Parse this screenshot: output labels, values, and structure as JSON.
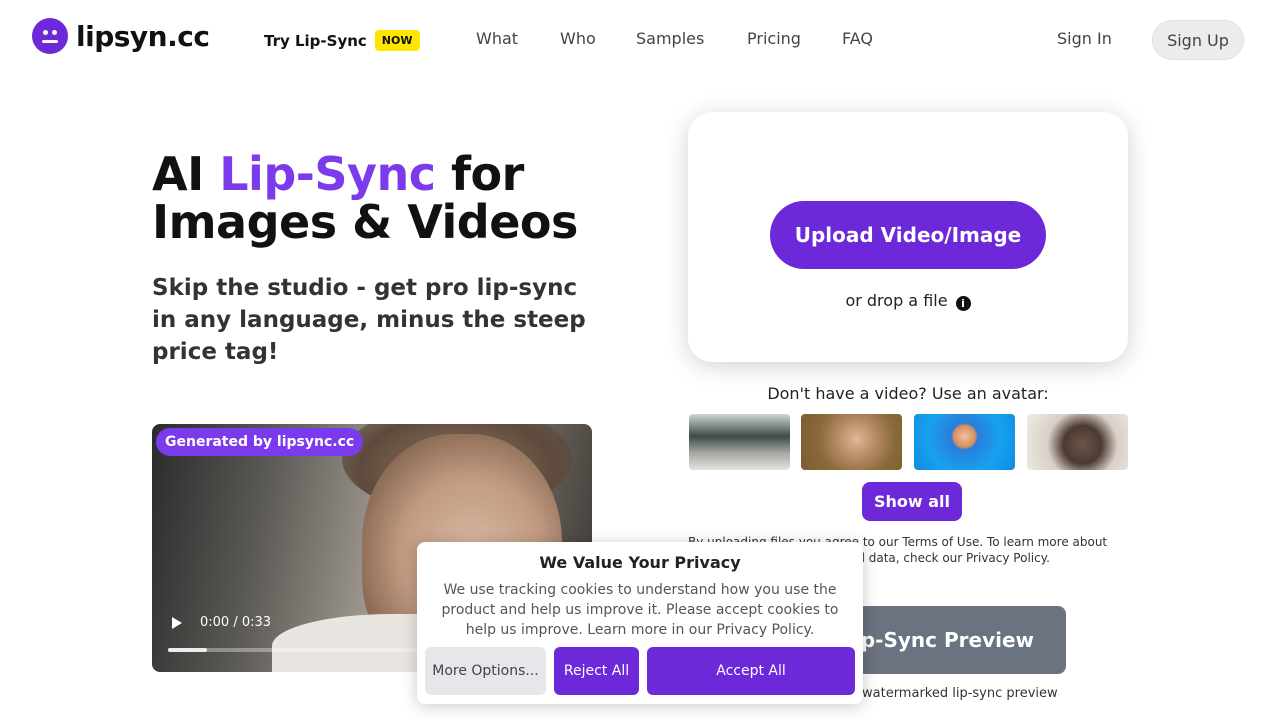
{
  "header": {
    "logo_text": "lipsyn.cc",
    "try_link": "Try Lip-Sync",
    "now_badge": "NOW",
    "nav": [
      "What",
      "Who",
      "Samples",
      "Pricing",
      "FAQ"
    ],
    "sign_in": "Sign In",
    "sign_up": "Sign Up"
  },
  "hero": {
    "title_prefix": "AI ",
    "title_accent": "Lip-Sync",
    "title_suffix": " for",
    "title_line2": "Images & Videos",
    "subtitle": "Skip the studio - get pro lip-sync in any language, minus the steep price tag!"
  },
  "video": {
    "badge": "Generated by lipsync.cc",
    "time": "0:00 / 0:33",
    "progress": 0.15
  },
  "upload": {
    "button": "Upload Video/Image",
    "drop_text": "or drop a file",
    "info_glyph": "i",
    "avatar_label": "Don't have a video? Use an avatar:",
    "show_all": "Show all",
    "terms": "By uploading files you agree to our Terms of Use. To learn more about how we handle your personal data, check our Privacy Policy.",
    "preview_button": "Lip-Sync Preview",
    "preview_note": "watermarked lip-sync preview"
  },
  "cookie": {
    "title": "We Value Your Privacy",
    "text": "We use tracking cookies to understand how you use the product and help us improve it. Please accept cookies to help us improve. Learn more in our Privacy Policy.",
    "more": "More Options...",
    "reject": "Reject All",
    "accept": "Accept All"
  },
  "colors": {
    "accent": "#7c3aed",
    "primary_button": "#6d28d9",
    "badge_yellow": "#ffe600",
    "disabled_button": "#6b7280"
  }
}
